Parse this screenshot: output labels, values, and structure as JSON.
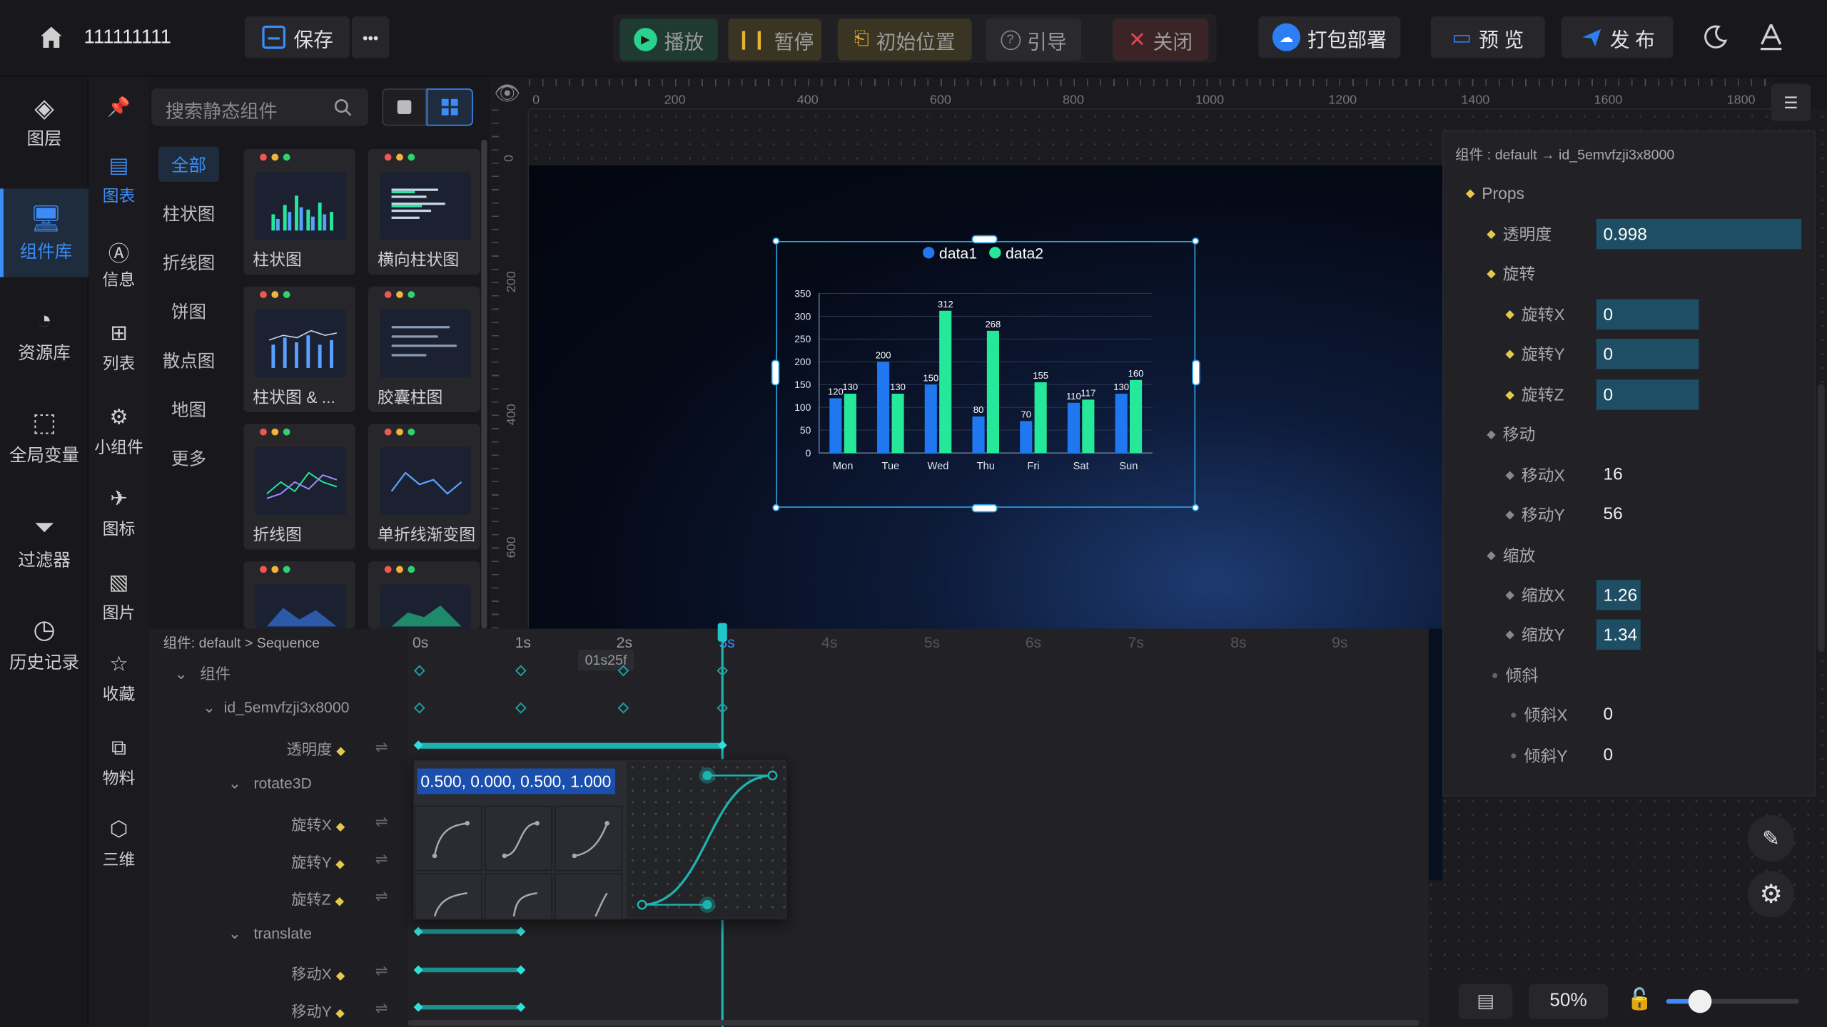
{
  "topbar": {
    "project_name": "111111111",
    "save": "保存",
    "more": "•••",
    "play": "播放",
    "pause": "暂停",
    "reset": "初始位置",
    "guide": "引导",
    "close": "关闭",
    "deploy": "打包部署",
    "preview": "预 览",
    "publish": "发 布"
  },
  "leftnav": {
    "items": [
      {
        "label": "图层",
        "icon": "layers-icon"
      },
      {
        "label": "组件库",
        "icon": "monitor-icon",
        "active": true
      },
      {
        "label": "资源库",
        "icon": "apple-icon"
      },
      {
        "label": "全局变量",
        "icon": "nodes-icon"
      },
      {
        "label": "过滤器",
        "icon": "filter-icon"
      },
      {
        "label": "历史记录",
        "icon": "clock-icon"
      }
    ]
  },
  "categories": [
    {
      "label": "图表",
      "icon": "chart-icon",
      "active": true
    },
    {
      "label": "信息",
      "icon": "text-icon"
    },
    {
      "label": "列表",
      "icon": "table-icon"
    },
    {
      "label": "小组件",
      "icon": "widget-icon"
    },
    {
      "label": "图标",
      "icon": "plane-icon"
    },
    {
      "label": "图片",
      "icon": "image-icon"
    },
    {
      "label": "收藏",
      "icon": "star-icon"
    },
    {
      "label": "物料",
      "icon": "material-icon"
    },
    {
      "label": "三维",
      "icon": "cube-icon"
    }
  ],
  "search": {
    "placeholder": "搜索静态组件"
  },
  "subcats": [
    "全部",
    "柱状图",
    "折线图",
    "饼图",
    "散点图",
    "地图",
    "更多"
  ],
  "components": [
    "柱状图",
    "横向柱状图",
    "柱状图 & ...",
    "胶囊柱图",
    "折线图",
    "单折线渐变图",
    "",
    ""
  ],
  "ruler": {
    "h": [
      "0",
      "200",
      "400",
      "600",
      "800",
      "1000",
      "1200",
      "1400",
      "1600",
      "1800"
    ],
    "v": [
      "0",
      "200",
      "400",
      "600"
    ]
  },
  "chart_data": {
    "type": "bar",
    "categories": [
      "Mon",
      "Tue",
      "Wed",
      "Thu",
      "Fri",
      "Sat",
      "Sun"
    ],
    "series": [
      {
        "name": "data1",
        "values": [
          120,
          200,
          150,
          80,
          70,
          110,
          130
        ],
        "color": "#1f78f0"
      },
      {
        "name": "data2",
        "values": [
          130,
          130,
          312,
          268,
          155,
          117,
          160
        ],
        "color": "#25e89b"
      }
    ],
    "ylim": [
      0,
      350
    ],
    "yticks": [
      "0",
      "50",
      "100",
      "150",
      "200",
      "250",
      "300",
      "350"
    ],
    "legend": "top-center"
  },
  "props": {
    "breadcrumb": "组件 : default → id_5emvfzji3x8000",
    "header": "Props",
    "opacity_label": "透明度",
    "opacity": "0.998",
    "rotate_label": "旋转",
    "rx_label": "旋转X",
    "rx": "0",
    "ry_label": "旋转Y",
    "ry": "0",
    "rz_label": "旋转Z",
    "rz": "0",
    "move_label": "移动",
    "mx_label": "移动X",
    "mx": "16",
    "my_label": "移动Y",
    "my": "56",
    "scale_label": "缩放",
    "sx_label": "缩放X",
    "sx": "1.26",
    "sy_label": "缩放Y",
    "sy": "1.34",
    "skew_label": "倾斜",
    "kx_label": "倾斜X",
    "kx": "0",
    "ky_label": "倾斜Y",
    "ky": "0"
  },
  "timeline": {
    "breadcrumb": "组件: default > Sequence",
    "times": [
      "0s",
      "1s",
      "2s",
      "3s",
      "4s",
      "5s",
      "6s",
      "7s",
      "8s",
      "9s"
    ],
    "cursor_time": "01s25f",
    "tracks": [
      "组件",
      "id_5emvfzji3x8000",
      "透明度",
      "rotate3D",
      "旋转X",
      "旋转Y",
      "旋转Z",
      "translate",
      "移动X",
      "移动Y"
    ],
    "easing_value": "0.500, 0.000, 0.500, 1.000"
  },
  "footer": {
    "zoom": "50%"
  }
}
